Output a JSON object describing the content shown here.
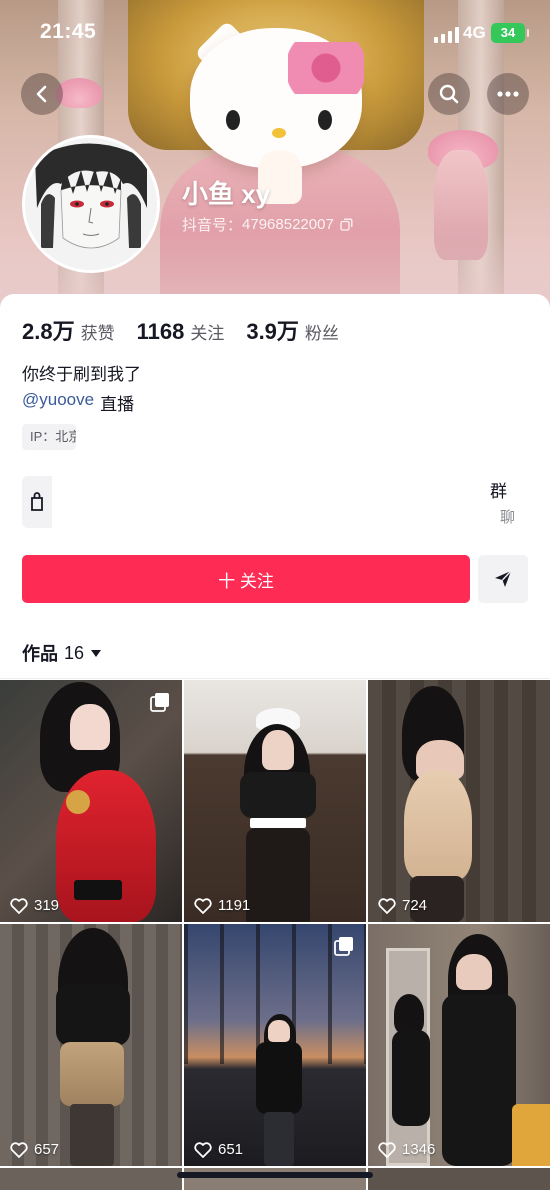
{
  "status_bar": {
    "time": "21:45",
    "network": "4G",
    "battery": "34"
  },
  "header": {
    "nickname": "小鱼 xy",
    "douyin_id_label": "抖音号：",
    "douyin_id": "47968522007",
    "icons": [
      "back-icon",
      "search-icon",
      "more-icon"
    ]
  },
  "stats": [
    {
      "num": "2.8万",
      "label": "获赞"
    },
    {
      "num": "1168",
      "label": "关注"
    },
    {
      "num": "3.9万",
      "label": "粉丝"
    }
  ],
  "bio": {
    "line1": "你终于刷到我了",
    "mention": "@yuoove",
    "mention_suffix": "直播",
    "ip": "IP：北京"
  },
  "shop": {
    "group_label": "群",
    "group_sub": "聊"
  },
  "actions": {
    "follow_label": "十 关注",
    "share_icon": "send-icon"
  },
  "works": {
    "label": "作品",
    "count": "16"
  },
  "videos": [
    {
      "likes": "319",
      "multi": true
    },
    {
      "likes": "1191",
      "multi": false
    },
    {
      "likes": "724",
      "multi": false
    },
    {
      "likes": "657",
      "multi": false
    },
    {
      "likes": "651",
      "multi": true
    },
    {
      "likes": "1346",
      "multi": false
    }
  ],
  "colors": {
    "accent": "#fe2c55",
    "mention": "#3b5b98",
    "battery": "#34c759"
  }
}
